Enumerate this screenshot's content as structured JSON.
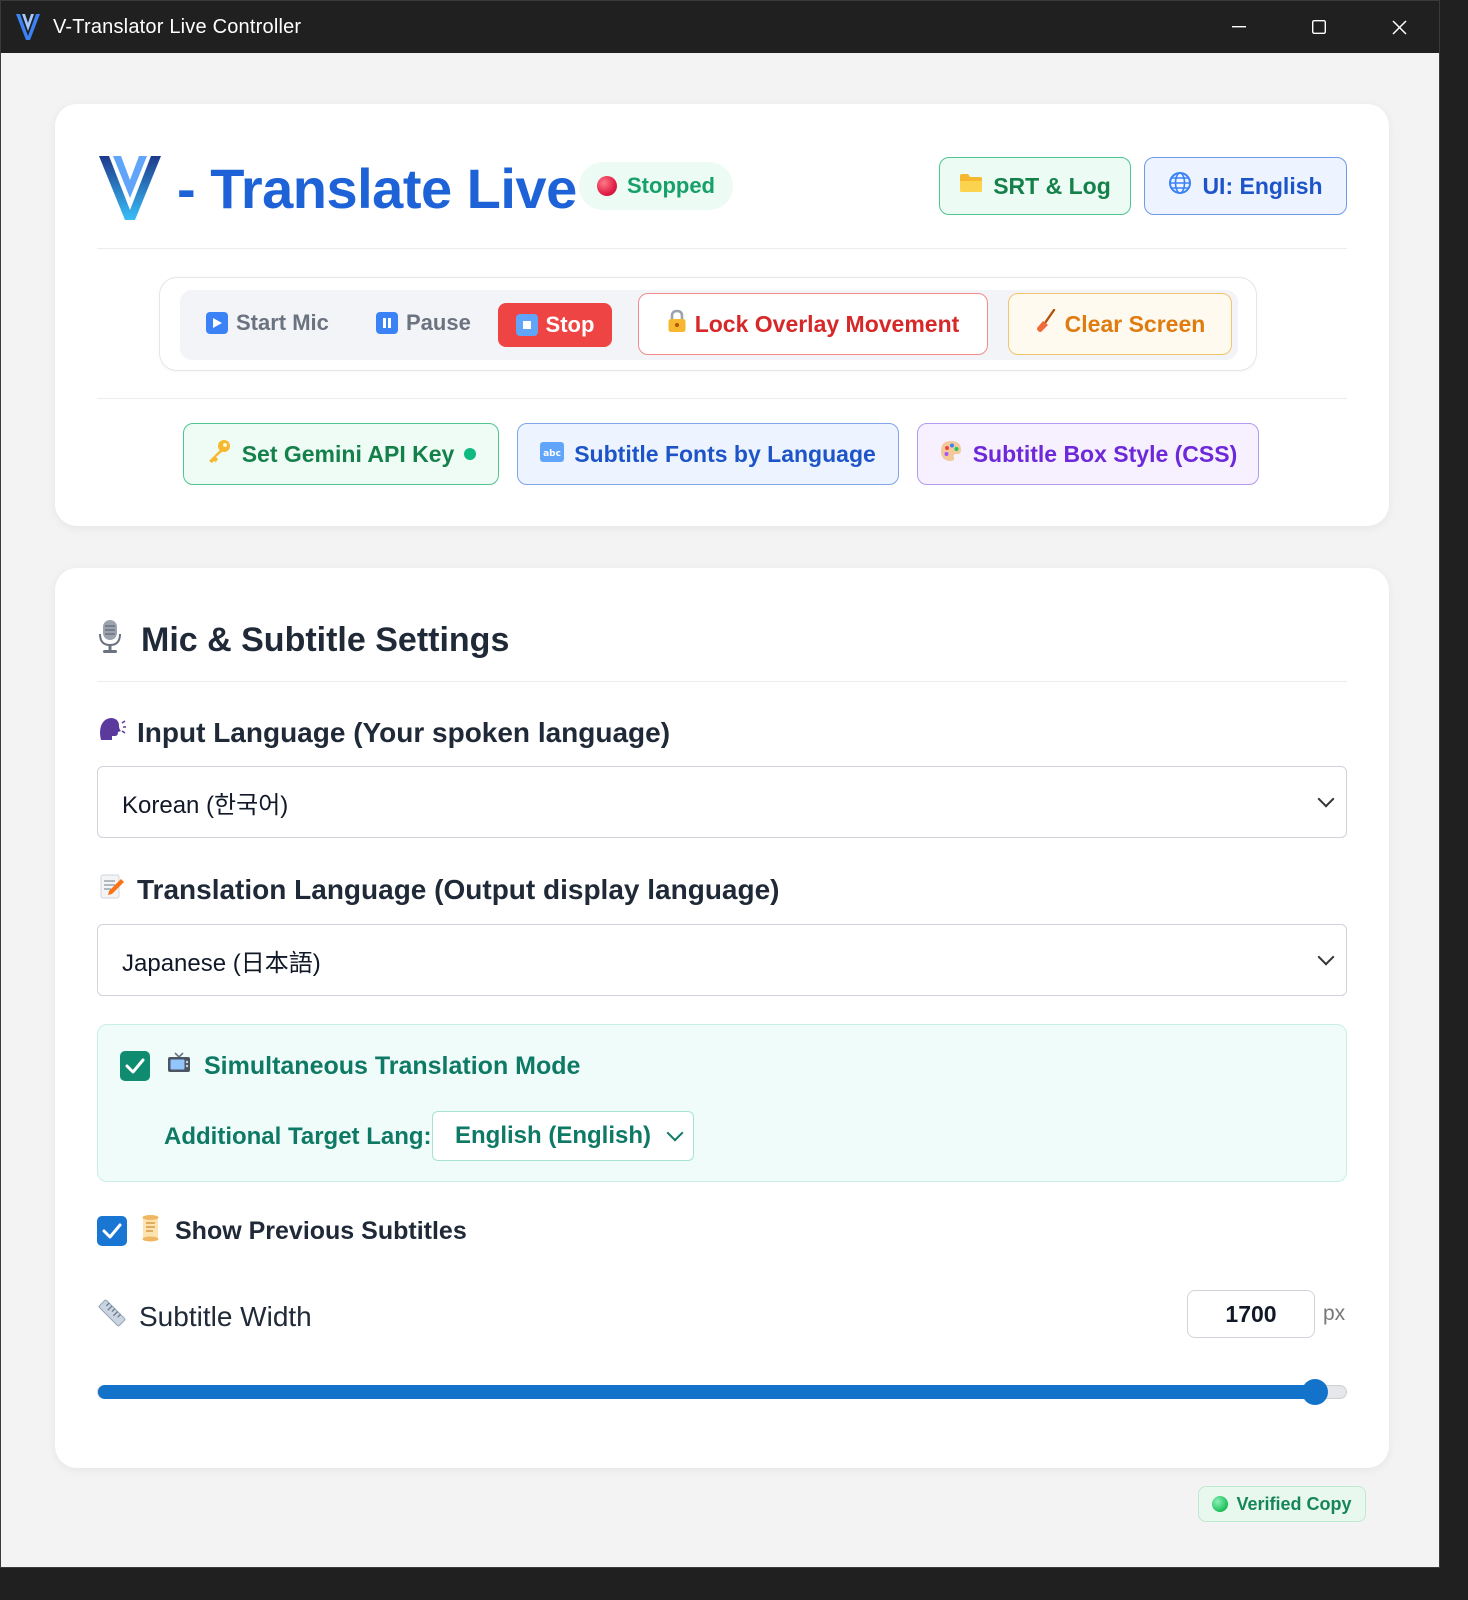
{
  "window": {
    "title": "V-Translator Live Controller"
  },
  "header": {
    "brand_title": "- Translate Live",
    "status": "Stopped",
    "srt_log_label": "SRT & Log",
    "ui_language_label": "UI: English"
  },
  "toolbar": {
    "start_mic": "Start Mic",
    "pause": "Pause",
    "stop": "Stop",
    "lock_overlay": "Lock Overlay Movement",
    "clear_screen": "Clear Screen"
  },
  "config": {
    "gemini_api_key": "Set Gemini API Key",
    "subtitle_fonts": "Subtitle Fonts by Language",
    "subtitle_box_style": "Subtitle Box Style (CSS)"
  },
  "settings": {
    "section_title": "Mic & Subtitle Settings",
    "input_language_label": "Input Language (Your spoken language)",
    "input_language_value": "Korean (한국어)",
    "translation_language_label": "Translation Language (Output display language)",
    "translation_language_value": "Japanese (日本語)",
    "simultaneous_mode_label": "Simultaneous Translation Mode",
    "simultaneous_mode_checked": true,
    "additional_target_label": "Additional Target Lang:",
    "additional_target_value": "English (English)",
    "show_previous_label": "Show Previous Subtitles",
    "show_previous_checked": true,
    "subtitle_width_label": "Subtitle Width",
    "subtitle_width_value": "1700",
    "subtitle_width_unit": "px",
    "subtitle_width_slider_fraction": 0.975
  },
  "footer": {
    "verified_label": "Verified Copy"
  },
  "colors": {
    "brand_blue": "#1d62d6",
    "stop_red": "#ef4444",
    "status_green": "#16a06a",
    "slider_blue": "#1372c9"
  }
}
